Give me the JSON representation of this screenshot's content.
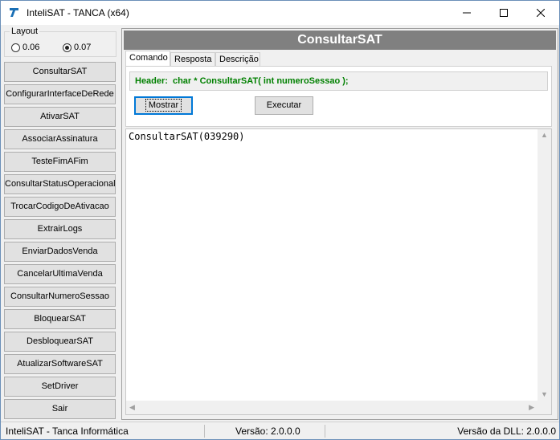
{
  "window": {
    "title": "InteliSAT - TANCA (x64)",
    "accent_color": "#0078d7"
  },
  "layout_group": {
    "legend": "Layout",
    "options": [
      "0.06",
      "0.07"
    ],
    "selected": "0.07"
  },
  "sidebar": {
    "buttons": [
      "ConsultarSAT",
      "ConfigurarInterfaceDeRede",
      "AtivarSAT",
      "AssociarAssinatura",
      "TesteFimAFim",
      "ConsultarStatusOperacional",
      "TrocarCodigoDeAtivacao",
      "ExtrairLogs",
      "EnviarDadosVenda",
      "CancelarUltimaVenda",
      "ConsultarNumeroSessao",
      "BloquearSAT",
      "DesbloquearSAT",
      "AtualizarSoftwareSAT",
      "SetDriver",
      "Sair"
    ]
  },
  "main": {
    "heading": "ConsultarSAT",
    "tabs": [
      "Comando",
      "Resposta",
      "Descrição"
    ],
    "active_tab": "Comando",
    "header_label": "Header:",
    "header_signature": "char * ConsultarSAT( int numeroSessao );",
    "header_color": "#008000",
    "show_button": "Mostrar",
    "execute_button": "Executar",
    "output": "ConsultarSAT(039290)"
  },
  "statusbar": {
    "company": "InteliSAT - Tanca Informática",
    "version": "Versão: 2.0.0.0",
    "dll_version": "Versão da DLL: 2.0.0.0"
  }
}
